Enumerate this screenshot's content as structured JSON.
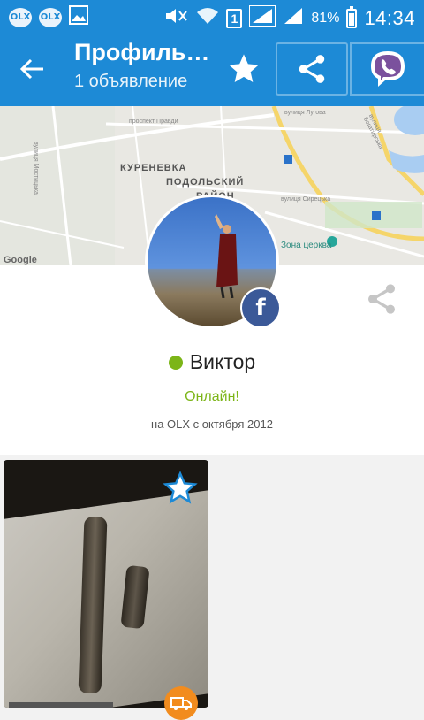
{
  "status_bar": {
    "app_icons": [
      "OLX",
      "OLX"
    ],
    "sim_slot": "1",
    "battery": "81%",
    "time": "14:34"
  },
  "app_bar": {
    "title": "Профиль…",
    "subtitle": "1 объявление"
  },
  "map": {
    "labels": {
      "district_1": "КУРЕНЕВКА",
      "district_2": "ПОДОЛЬСКИЙ",
      "district_3": "РАЙОН",
      "street_1": "проспект Правди",
      "street_2": "вулиця Лугова",
      "street_3": "вулиця Мостицька",
      "street_4": "вулиця Сирецька",
      "street_5": "вулиця Богатирська",
      "poi_1": "Зона церква",
      "attribution": "Google"
    }
  },
  "profile": {
    "name": "Виктор",
    "status": "Онлайн!",
    "since": "на OLX с октября 2012",
    "online_color": "#7cb518",
    "facebook_badge": "f"
  },
  "colors": {
    "primary": "#1d8ad6",
    "facebook": "#3b5998",
    "delivery": "#f28c1e"
  }
}
